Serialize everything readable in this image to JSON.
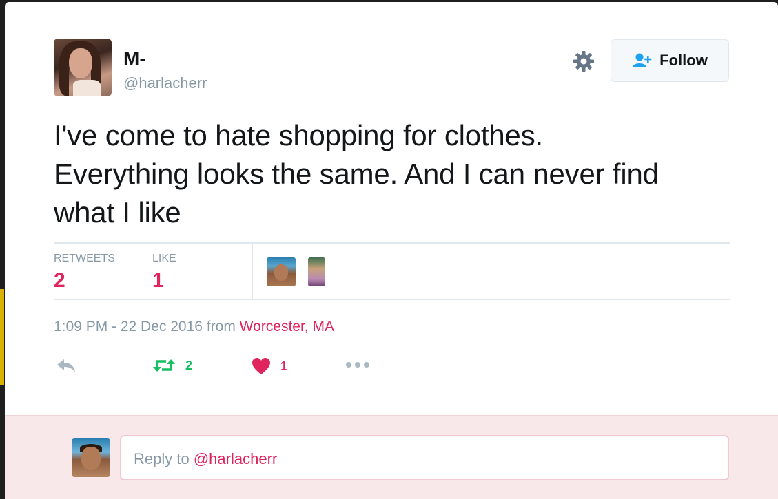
{
  "author": {
    "display_name": "M-",
    "handle": "@harlacherr"
  },
  "header": {
    "follow_label": "Follow"
  },
  "tweet": {
    "lines": [
      "I've come to hate shopping for clothes.",
      "Everything looks the same. And I can never find",
      "what I like"
    ]
  },
  "stats": {
    "retweets_label": "RETWEETS",
    "retweets_value": "2",
    "likes_label": "LIKE",
    "likes_value": "1"
  },
  "meta": {
    "time_date": "1:09 PM - 22 Dec 2016",
    "from_word": "from",
    "location": "Worcester, MA"
  },
  "actions": {
    "retweet_count": "2",
    "like_count": "1"
  },
  "reply": {
    "prefix": "Reply to",
    "mention": "@harlacherr"
  },
  "colors": {
    "accent_red": "#e0245e",
    "retweet_green": "#17bf63",
    "muted": "#8899a6",
    "follow_icon_blue": "#1da1f2",
    "reply_bg": "#f8e8ea"
  },
  "icons": {
    "settings": "gear-icon",
    "follow": "add-user-icon",
    "reply": "reply-arrow-icon",
    "retweet": "retweet-icon",
    "like": "heart-icon",
    "more": "more-dots-icon"
  }
}
